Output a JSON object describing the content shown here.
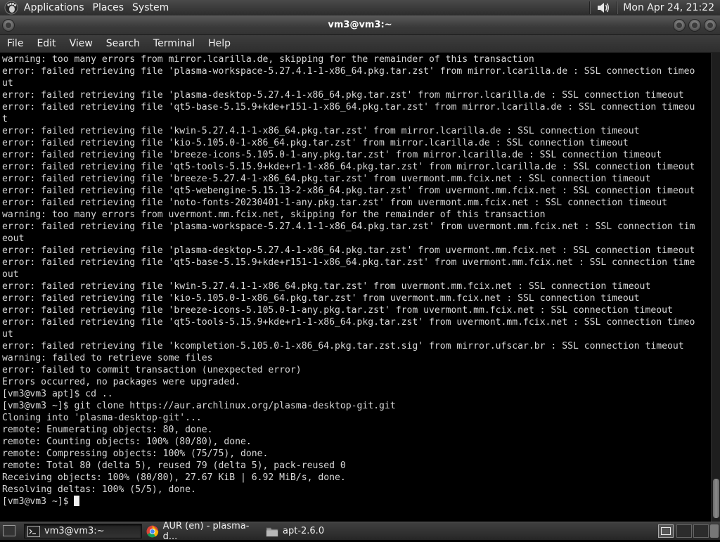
{
  "top_panel": {
    "menus": [
      "Applications",
      "Places",
      "System"
    ],
    "clock": "Mon Apr 24, 21:22",
    "volume_icon": "speaker-icon",
    "logo_icon": "gnome-foot-icon"
  },
  "window": {
    "title": "vm3@vm3:~"
  },
  "menubar": [
    "File",
    "Edit",
    "View",
    "Search",
    "Terminal",
    "Help"
  ],
  "terminal": {
    "lines": [
      "warning: too many errors from mirror.lcarilla.de, skipping for the remainder of this transaction",
      "error: failed retrieving file 'plasma-workspace-5.27.4.1-1-x86_64.pkg.tar.zst' from mirror.lcarilla.de : SSL connection timeo",
      "ut",
      "error: failed retrieving file 'plasma-desktop-5.27.4-1-x86_64.pkg.tar.zst' from mirror.lcarilla.de : SSL connection timeout",
      "error: failed retrieving file 'qt5-base-5.15.9+kde+r151-1-x86_64.pkg.tar.zst' from mirror.lcarilla.de : SSL connection timeou",
      "t",
      "error: failed retrieving file 'kwin-5.27.4.1-1-x86_64.pkg.tar.zst' from mirror.lcarilla.de : SSL connection timeout",
      "error: failed retrieving file 'kio-5.105.0-1-x86_64.pkg.tar.zst' from mirror.lcarilla.de : SSL connection timeout",
      "error: failed retrieving file 'breeze-icons-5.105.0-1-any.pkg.tar.zst' from mirror.lcarilla.de : SSL connection timeout",
      "error: failed retrieving file 'qt5-tools-5.15.9+kde+r1-1-x86_64.pkg.tar.zst' from mirror.lcarilla.de : SSL connection timeout",
      "error: failed retrieving file 'breeze-5.27.4-1-x86_64.pkg.tar.zst' from uvermont.mm.fcix.net : SSL connection timeout",
      "error: failed retrieving file 'qt5-webengine-5.15.13-2-x86_64.pkg.tar.zst' from uvermont.mm.fcix.net : SSL connection timeout",
      "error: failed retrieving file 'noto-fonts-20230401-1-any.pkg.tar.zst' from uvermont.mm.fcix.net : SSL connection timeout",
      "warning: too many errors from uvermont.mm.fcix.net, skipping for the remainder of this transaction",
      "error: failed retrieving file 'plasma-workspace-5.27.4.1-1-x86_64.pkg.tar.zst' from uvermont.mm.fcix.net : SSL connection tim",
      "eout",
      "error: failed retrieving file 'plasma-desktop-5.27.4-1-x86_64.pkg.tar.zst' from uvermont.mm.fcix.net : SSL connection timeout",
      "error: failed retrieving file 'qt5-base-5.15.9+kde+r151-1-x86_64.pkg.tar.zst' from uvermont.mm.fcix.net : SSL connection time",
      "out",
      "error: failed retrieving file 'kwin-5.27.4.1-1-x86_64.pkg.tar.zst' from uvermont.mm.fcix.net : SSL connection timeout",
      "error: failed retrieving file 'kio-5.105.0-1-x86_64.pkg.tar.zst' from uvermont.mm.fcix.net : SSL connection timeout",
      "error: failed retrieving file 'breeze-icons-5.105.0-1-any.pkg.tar.zst' from uvermont.mm.fcix.net : SSL connection timeout",
      "error: failed retrieving file 'qt5-tools-5.15.9+kde+r1-1-x86_64.pkg.tar.zst' from uvermont.mm.fcix.net : SSL connection timeo",
      "ut",
      "error: failed retrieving file 'kcompletion-5.105.0-1-x86_64.pkg.tar.zst.sig' from mirror.ufscar.br : SSL connection timeout",
      "warning: failed to retrieve some files",
      "error: failed to commit transaction (unexpected error)",
      "Errors occurred, no packages were upgraded.",
      "[vm3@vm3 apt]$ cd ..",
      "[vm3@vm3 ~]$ git clone https://aur.archlinux.org/plasma-desktop-git.git",
      "Cloning into 'plasma-desktop-git'...",
      "remote: Enumerating objects: 80, done.",
      "remote: Counting objects: 100% (80/80), done.",
      "remote: Compressing objects: 100% (75/75), done.",
      "remote: Total 80 (delta 5), reused 79 (delta 5), pack-reused 0",
      "Receiving objects: 100% (80/80), 27.67 KiB | 6.92 MiB/s, done.",
      "Resolving deltas: 100% (5/5), done."
    ],
    "prompt": "[vm3@vm3 ~]$ "
  },
  "taskbar": {
    "tasks": [
      {
        "label": "vm3@vm3:~",
        "icon": "terminal-icon",
        "active": true
      },
      {
        "label": "AUR (en) - plasma-d...",
        "icon": "chrome-icon",
        "active": false
      },
      {
        "label": "apt-2.6.0",
        "icon": "folder-icon",
        "active": false
      }
    ],
    "workspace_icon": "workspace-switcher-icon"
  }
}
